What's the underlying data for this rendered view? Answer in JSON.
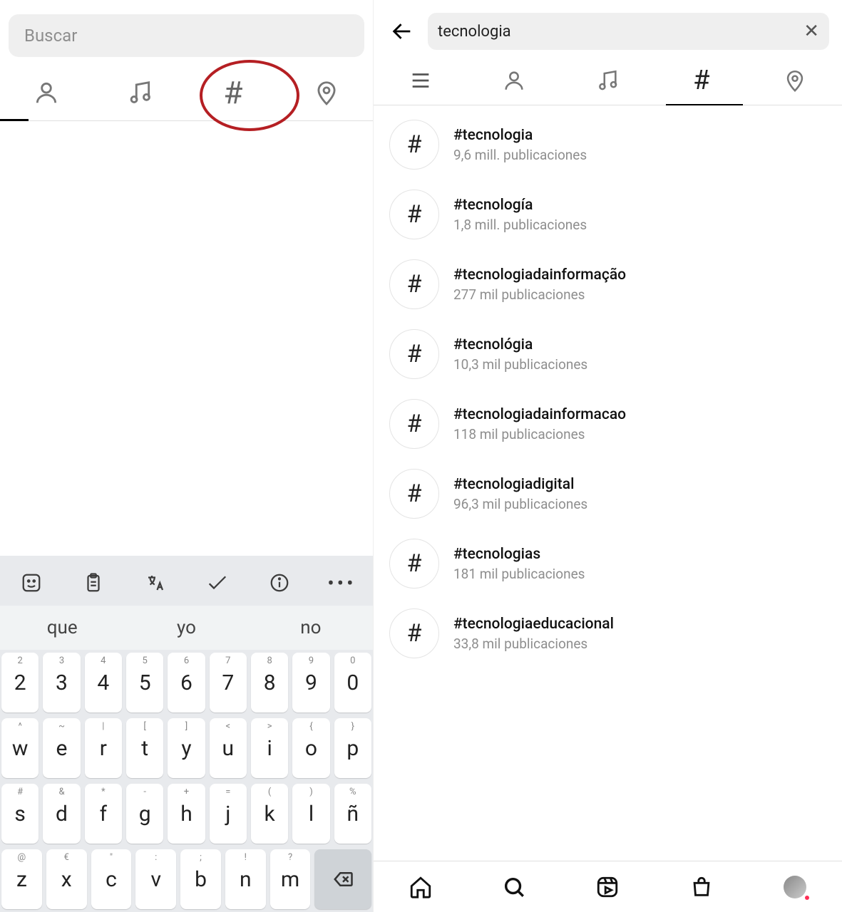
{
  "left": {
    "search_placeholder": "Buscar",
    "tabs": {
      "person": "person",
      "music": "music",
      "hash": "#",
      "location": "location"
    },
    "keyboard": {
      "suggestions": [
        "que",
        "yo",
        "no"
      ],
      "row1": [
        {
          "t": "2",
          "m": "2"
        },
        {
          "t": "3",
          "m": "3"
        },
        {
          "t": "4",
          "m": "4"
        },
        {
          "t": "5",
          "m": "5"
        },
        {
          "t": "6",
          "m": "6"
        },
        {
          "t": "7",
          "m": "7"
        },
        {
          "t": "8",
          "m": "8"
        },
        {
          "t": "9",
          "m": "9"
        },
        {
          "t": "0",
          "m": "0"
        }
      ],
      "row2": [
        {
          "t": "^",
          "m": "w"
        },
        {
          "t": "~",
          "m": "e"
        },
        {
          "t": "|",
          "m": "r"
        },
        {
          "t": "[",
          "m": "t"
        },
        {
          "t": "]",
          "m": "y"
        },
        {
          "t": "<",
          "m": "u"
        },
        {
          "t": ">",
          "m": "i"
        },
        {
          "t": "{",
          "m": "o"
        },
        {
          "t": "}",
          "m": "p"
        }
      ],
      "row3": [
        {
          "t": "#",
          "m": "s"
        },
        {
          "t": "&",
          "m": "d"
        },
        {
          "t": "*",
          "m": "f"
        },
        {
          "t": "-",
          "m": "g"
        },
        {
          "t": "+",
          "m": "h"
        },
        {
          "t": "=",
          "m": "j"
        },
        {
          "t": "(",
          "m": "k"
        },
        {
          "t": ")",
          "m": "l"
        },
        {
          "t": "%",
          "m": "ñ"
        }
      ],
      "row4": [
        {
          "t": "@",
          "m": "z"
        },
        {
          "t": "€",
          "m": "x"
        },
        {
          "t": "\"",
          "m": "c"
        },
        {
          "t": ":",
          "m": "v"
        },
        {
          "t": ";",
          "m": "b"
        },
        {
          "t": "!",
          "m": "n"
        },
        {
          "t": "?",
          "m": "m"
        }
      ]
    }
  },
  "right": {
    "search_value": "tecnologia",
    "results": [
      {
        "title": "#tecnologia",
        "sub": "9,6 mill. publicaciones"
      },
      {
        "title": "#tecnología",
        "sub": "1,8 mill. publicaciones"
      },
      {
        "title": "#tecnologiadainformação",
        "sub": "277 mil publicaciones"
      },
      {
        "title": "#tecnológia",
        "sub": "10,3 mil publicaciones"
      },
      {
        "title": "#tecnologiadainformacao",
        "sub": "118 mil publicaciones"
      },
      {
        "title": "#tecnologiadigital",
        "sub": "96,3 mil publicaciones"
      },
      {
        "title": "#tecnologias",
        "sub": "181 mil publicaciones"
      },
      {
        "title": "#tecnologiaeducacional",
        "sub": "33,8 mil publicaciones"
      }
    ]
  }
}
